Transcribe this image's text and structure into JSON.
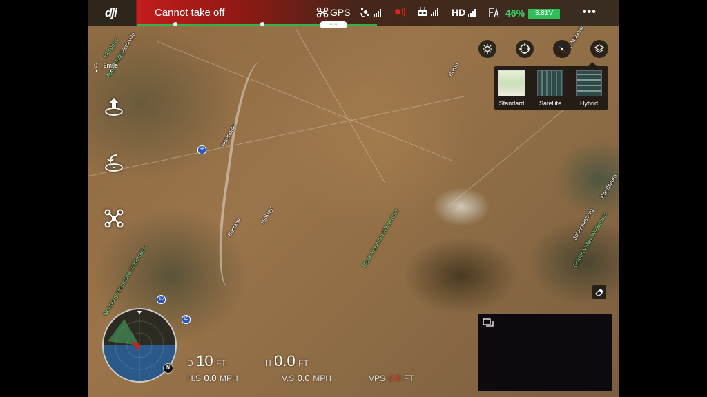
{
  "topbar": {
    "logo": "dji",
    "status_message": "Cannot take off",
    "gps_label": "GPS",
    "gps_pill": "··:··",
    "hd_label": "HD",
    "battery_percent": "46%",
    "battery_voltage": "3.81V",
    "more_icon": "•••",
    "colors": {
      "alert": "#c41c1c",
      "battery": "#2fbf5a",
      "progress": "#38b04a"
    }
  },
  "map": {
    "scale": {
      "start": "0",
      "end": "2mile"
    },
    "labels": [
      {
        "text": "Apple Valley"
      },
      {
        "text": "Victorville"
      },
      {
        "text": "Hesperia"
      },
      {
        "text": "Helendale"
      },
      {
        "text": "Hinkley"
      },
      {
        "text": "Barstow"
      },
      {
        "text": "Johannesburg"
      },
      {
        "text": "Randsburg"
      },
      {
        "text": "Golden Valley Wilderness"
      },
      {
        "text": "Black Mountain Wilderness"
      },
      {
        "text": "Newberry Mountains Wilderness"
      },
      {
        "text": "Boron"
      },
      {
        "text": "Red Mountain"
      }
    ],
    "shields": [
      "58",
      "15",
      "15"
    ]
  },
  "left_tools": [
    {
      "name": "takeoff",
      "icon": "takeoff-icon"
    },
    {
      "name": "return-home",
      "icon": "return-home-icon"
    },
    {
      "name": "aircraft-mode",
      "icon": "aircraft-icon"
    }
  ],
  "map_controls": {
    "buttons": [
      "settings-icon",
      "locate-icon",
      "compass-icon",
      "layers-icon"
    ],
    "map_types": [
      {
        "label": "Standard"
      },
      {
        "label": "Satellite"
      },
      {
        "label": "Hybrid"
      }
    ]
  },
  "radar": {
    "north": "N"
  },
  "telemetry": {
    "distance": {
      "key": "D",
      "value": "10",
      "unit": "FT"
    },
    "height": {
      "key": "H",
      "value": "0.0",
      "unit": "FT"
    },
    "h_speed": {
      "key": "H.S",
      "value": "0.0",
      "unit": "MPH"
    },
    "v_speed": {
      "key": "V.S",
      "value": "0.0",
      "unit": "MPH"
    },
    "vps": {
      "key": "VPS",
      "value": "0.0",
      "unit": "FT"
    }
  }
}
